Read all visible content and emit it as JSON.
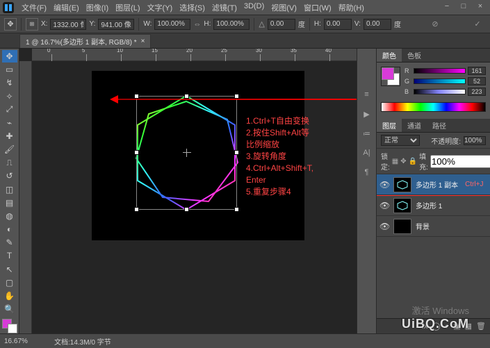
{
  "menu": [
    "文件(F)",
    "编辑(E)",
    "图像(I)",
    "图层(L)",
    "文字(Y)",
    "选择(S)",
    "滤镜(T)",
    "3D(D)",
    "视图(V)",
    "窗口(W)",
    "帮助(H)"
  ],
  "opt": {
    "x_label": "X:",
    "x": "1332.00 像",
    "y_label": "Y:",
    "y": "941.00 像",
    "w_label": "W:",
    "w": "100.00%",
    "h_label": "H:",
    "h": "100.00%",
    "ang_label": "度",
    "ang": "0.00",
    "sh_label": "H:",
    "sh": "0.00",
    "sv_label": "V:",
    "sv": "0.00",
    "deg": "度"
  },
  "tab": {
    "title": "1 @ 16.7%(多边形 1 副本, RGB/8) *",
    "close": "×"
  },
  "ruler_ticks": [
    {
      "pos": 28,
      "label": "0"
    },
    {
      "pos": 78,
      "label": "5"
    },
    {
      "pos": 128,
      "label": "10"
    },
    {
      "pos": 178,
      "label": "15"
    },
    {
      "pos": 228,
      "label": "20"
    },
    {
      "pos": 278,
      "label": "25"
    },
    {
      "pos": 328,
      "label": "30"
    },
    {
      "pos": 378,
      "label": "35"
    },
    {
      "pos": 428,
      "label": "40"
    }
  ],
  "instructions": [
    "1.Ctrl+T自由变换",
    "2.按住Shift+Alt等比例缩放",
    "3.旋转角度",
    "4.Ctrl+Alt+Shift+T, Enter",
    "5.重复步骤4"
  ],
  "color_panel": {
    "tabs": [
      "颜色",
      "色板"
    ],
    "sliders": [
      {
        "lab": "R",
        "grad": "linear-gradient(to right,#000,#f0f)",
        "val": "161"
      },
      {
        "lab": "G",
        "grad": "linear-gradient(to right,#007,#0ff)",
        "val": "52"
      },
      {
        "lab": "B",
        "grad": "linear-gradient(to right,#000,#88f,#fff)",
        "val": "223"
      }
    ]
  },
  "layer_panel": {
    "tabs": [
      "图层",
      "通道",
      "路径"
    ],
    "blend": "正常",
    "opacity_label": "不透明度:",
    "opacity": "100%",
    "lock_label": "锁定:",
    "fill_label": "填充:",
    "fill": "100%",
    "layers": [
      {
        "name": "多边形 1 副本",
        "extra": "Ctrl+J",
        "selected": true,
        "icon": "hex"
      },
      {
        "name": "多边形 1",
        "extra": "",
        "selected": false,
        "icon": "hex"
      },
      {
        "name": "背景",
        "extra": "",
        "selected": false,
        "icon": "bg"
      }
    ]
  },
  "status": {
    "zoom": "16.67%",
    "doc": "文档:14.3M/0 字节"
  },
  "watermark": {
    "line1": "激活 Windows",
    "line2": "UiBQ.CoM"
  }
}
